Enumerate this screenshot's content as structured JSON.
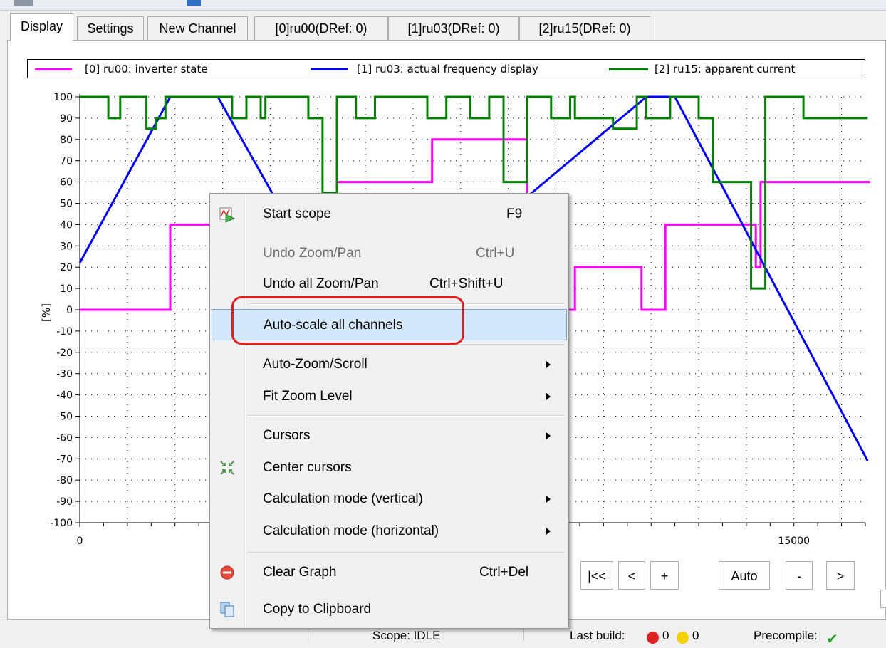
{
  "tabs": [
    {
      "label": "Display",
      "active": true
    },
    {
      "label": "Settings",
      "active": false
    },
    {
      "label": "New Channel",
      "active": false
    },
    {
      "label": "[0]ru00(DRef: 0)",
      "active": false
    },
    {
      "label": "[1]ru03(DRef: 0)",
      "active": false
    },
    {
      "label": "[2]ru15(DRef: 0)",
      "active": false
    }
  ],
  "legend": [
    {
      "label": "[0] ru00: inverter state",
      "color": "#ff00ff"
    },
    {
      "label": "[1] ru03: actual frequency display",
      "color": "#0000ff"
    },
    {
      "label": "[2] ru15: apparent current",
      "color": "#008000"
    }
  ],
  "y_axis_label": "[%]",
  "chart_data": {
    "type": "line",
    "ylabel": "[%]",
    "ylim": [
      -100,
      100
    ],
    "xlim": [
      0,
      16500
    ],
    "yticks": [
      100,
      90,
      80,
      70,
      60,
      50,
      40,
      30,
      20,
      10,
      0,
      -10,
      -20,
      -30,
      -40,
      -50,
      -60,
      -70,
      -80,
      -90,
      -100
    ],
    "xticks": [
      {
        "value": 0,
        "label": "0"
      },
      {
        "value": 15000,
        "label": "15000"
      }
    ],
    "grid": true,
    "legend_position": "top",
    "series": [
      {
        "name": "[0] ru00: inverter state",
        "color": "#ff00ff",
        "x": [
          0,
          1900,
          1900,
          3400,
          3400,
          5400,
          5400,
          7400,
          7400,
          9400,
          9400,
          10400,
          10400,
          11800,
          11800,
          12300,
          12300,
          14200,
          14200,
          14300,
          14300,
          16600
        ],
        "y": [
          0,
          0,
          40,
          40,
          0,
          0,
          60,
          60,
          80,
          80,
          0,
          0,
          20,
          20,
          0,
          0,
          40,
          40,
          20,
          20,
          60,
          60
        ]
      },
      {
        "name": "[1] ru03: actual frequency display",
        "color": "#0000ff",
        "x": [
          0,
          1900,
          2900,
          5300,
          6300,
          11900,
          12500,
          16550
        ],
        "y": [
          22,
          100,
          100,
          5,
          -5,
          100,
          100,
          -71
        ]
      },
      {
        "name": "[2] ru15: apparent current",
        "color": "#008000",
        "x": [
          0,
          600,
          600,
          850,
          850,
          1400,
          1400,
          1600,
          1600,
          1800,
          1800,
          3200,
          3200,
          3500,
          3500,
          3800,
          3800,
          3900,
          3900,
          4800,
          4800,
          5100,
          5100,
          5400,
          5400,
          5800,
          5800,
          6200,
          6200,
          7300,
          7300,
          7700,
          7700,
          8200,
          8200,
          8600,
          8600,
          8900,
          8900,
          9400,
          9400,
          9900,
          9900,
          10300,
          10300,
          10400,
          10400,
          11200,
          11200,
          11700,
          11700,
          11900,
          11900,
          12400,
          12400,
          13000,
          13000,
          13300,
          13300,
          14100,
          14100,
          14400,
          14400,
          15200,
          15200,
          15600,
          15600,
          16550
        ],
        "y": [
          100,
          100,
          90,
          90,
          100,
          100,
          85,
          85,
          90,
          90,
          100,
          100,
          90,
          90,
          100,
          100,
          90,
          90,
          100,
          100,
          90,
          90,
          55,
          55,
          100,
          100,
          90,
          90,
          100,
          100,
          90,
          90,
          100,
          100,
          90,
          90,
          100,
          100,
          60,
          60,
          100,
          100,
          90,
          90,
          100,
          100,
          90,
          90,
          85,
          85,
          100,
          100,
          90,
          90,
          100,
          100,
          90,
          90,
          60,
          60,
          10,
          10,
          100,
          100,
          90,
          90,
          90,
          90
        ]
      }
    ]
  },
  "nav_buttons": [
    "|<<",
    "<",
    "+",
    "Auto",
    "-",
    ">"
  ],
  "status": {
    "scope": "Scope: IDLE",
    "last_build": "Last build:",
    "errors": "0",
    "warnings": "0",
    "precompile": "Precompile:"
  },
  "context_menu": {
    "items": [
      {
        "label": "Start scope",
        "shortcut": "F9",
        "icon": "start-scope-icon",
        "disabled": false
      },
      {
        "label": "Undo Zoom/Pan",
        "shortcut": "Ctrl+U",
        "disabled": true
      },
      {
        "label": "Undo all Zoom/Pan",
        "shortcut": "Ctrl+Shift+U",
        "disabled": false
      },
      {
        "label": "Auto-scale all channels",
        "shortcut": "",
        "disabled": false,
        "highlighted": true
      },
      {
        "label": "Auto-Zoom/Scroll",
        "submenu": true
      },
      {
        "label": "Fit Zoom Level",
        "submenu": true
      },
      {
        "label": "Cursors",
        "submenu": true
      },
      {
        "label": "Center cursors",
        "icon": "center-cursors-icon"
      },
      {
        "label": "Calculation mode (vertical)",
        "submenu": true
      },
      {
        "label": "Calculation mode (horizontal)",
        "submenu": true
      },
      {
        "label": "Clear Graph",
        "shortcut": "Ctrl+Del",
        "icon": "clear-graph-icon"
      },
      {
        "label": "Copy to Clipboard",
        "icon": "copy-icon"
      }
    ]
  }
}
